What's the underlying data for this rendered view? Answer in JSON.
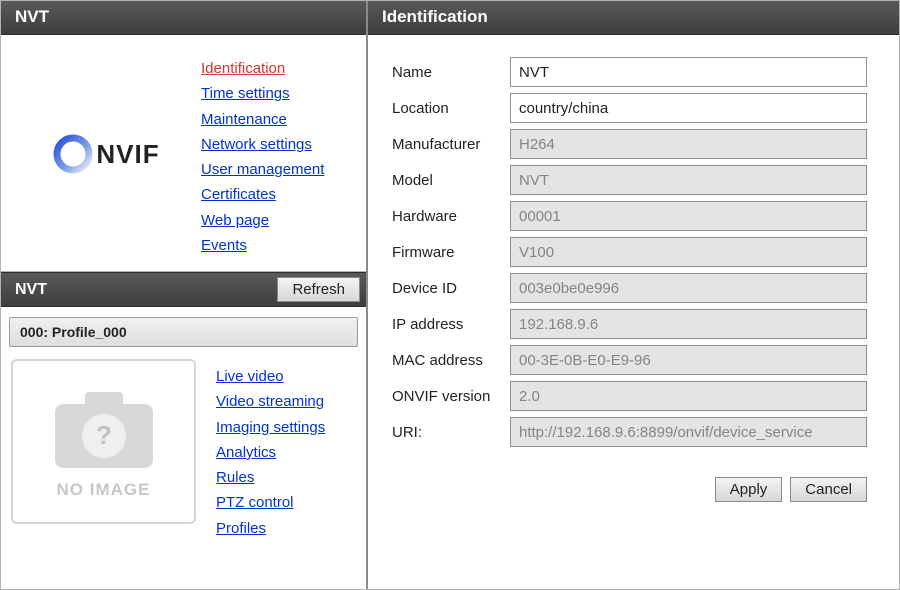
{
  "left": {
    "device_title": "NVT",
    "nav_top": [
      {
        "label": "Identification",
        "active": true
      },
      {
        "label": "Time settings"
      },
      {
        "label": "Maintenance"
      },
      {
        "label": "Network settings"
      },
      {
        "label": "User management"
      },
      {
        "label": "Certificates"
      },
      {
        "label": "Web page"
      },
      {
        "label": "Events"
      }
    ],
    "profiles_title": "NVT",
    "refresh_label": "Refresh",
    "profile_row": "000: Profile_000",
    "no_image_label": "NO IMAGE",
    "nav_bottom": [
      {
        "label": "Live video"
      },
      {
        "label": "Video streaming"
      },
      {
        "label": "Imaging settings"
      },
      {
        "label": "Analytics"
      },
      {
        "label": "Rules"
      },
      {
        "label": "PTZ control"
      },
      {
        "label": "Profiles"
      }
    ]
  },
  "right": {
    "title": "Identification",
    "fields": {
      "name": {
        "label": "Name",
        "value": "NVT",
        "editable": true
      },
      "location": {
        "label": "Location",
        "value": "country/china",
        "editable": true
      },
      "manufacturer": {
        "label": "Manufacturer",
        "value": "H264",
        "editable": false
      },
      "model": {
        "label": "Model",
        "value": "NVT",
        "editable": false
      },
      "hardware": {
        "label": "Hardware",
        "value": "00001",
        "editable": false
      },
      "firmware": {
        "label": "Firmware",
        "value": "V100",
        "editable": false
      },
      "device_id": {
        "label": "Device ID",
        "value": "003e0be0e996",
        "editable": false
      },
      "ip": {
        "label": "IP address",
        "value": "192.168.9.6",
        "editable": false
      },
      "mac": {
        "label": "MAC address",
        "value": "00-3E-0B-E0-E9-96",
        "editable": false
      },
      "onvif_ver": {
        "label": "ONVIF version",
        "value": "2.0",
        "editable": false
      },
      "uri": {
        "label": "URI:",
        "value": "http://192.168.9.6:8899/onvif/device_service",
        "editable": false
      }
    },
    "apply_label": "Apply",
    "cancel_label": "Cancel"
  }
}
